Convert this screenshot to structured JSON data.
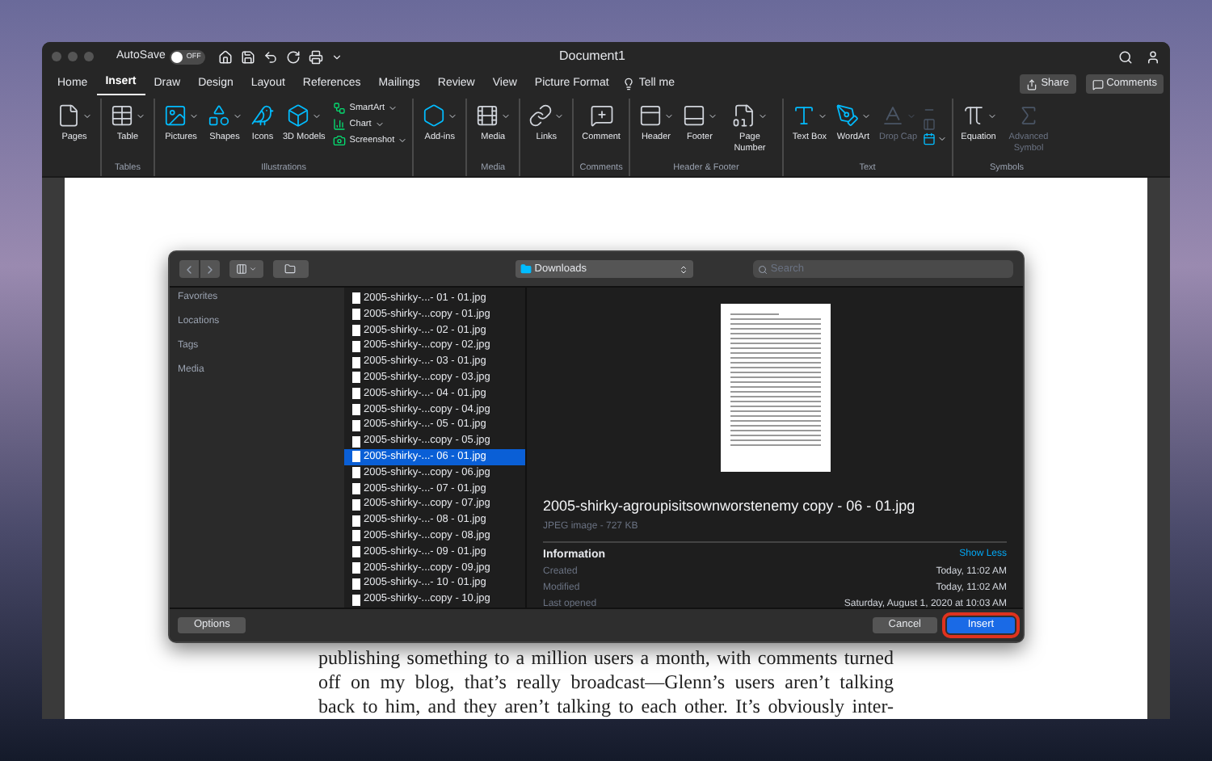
{
  "window": {
    "title": "Document1",
    "autosave": {
      "label": "AutoSave",
      "on": false,
      "state_label": "OFF"
    }
  },
  "tabs": [
    {
      "label": "Home",
      "selected": false
    },
    {
      "label": "Insert",
      "selected": true
    },
    {
      "label": "Draw",
      "selected": false
    },
    {
      "label": "Design",
      "selected": false
    },
    {
      "label": "Layout",
      "selected": false
    },
    {
      "label": "References",
      "selected": false
    },
    {
      "label": "Mailings",
      "selected": false
    },
    {
      "label": "Review",
      "selected": false
    },
    {
      "label": "View",
      "selected": false
    },
    {
      "label": "Picture Format",
      "selected": false
    }
  ],
  "tell_me": "Tell me",
  "share_button": "Share",
  "comments_button": "Comments",
  "ribbon": {
    "groups": [
      {
        "items": [
          {
            "label": "Pages",
            "kind": "menu_button",
            "disabled": false
          }
        ]
      },
      {
        "label": "Tables",
        "items": [
          {
            "label": "Table",
            "kind": "menu_button",
            "disabled": false
          }
        ]
      },
      {
        "label": "Illustrations",
        "items": [
          {
            "label": "Pictures",
            "kind": "menu_button",
            "disabled": false
          },
          {
            "label": "Shapes",
            "kind": "menu_button",
            "disabled": false
          },
          {
            "label": "Icons",
            "kind": "button",
            "disabled": false
          },
          {
            "label": "3D Models",
            "kind": "menu_button",
            "disabled": false
          },
          {
            "label": "SmartArt",
            "kind": "small_menu",
            "disabled": false
          },
          {
            "label": "Chart",
            "kind": "small_menu",
            "disabled": false
          },
          {
            "label": "Screenshot",
            "kind": "small_menu",
            "disabled": false
          }
        ]
      },
      {
        "items": [
          {
            "label": "Add-ins",
            "kind": "menu_button",
            "disabled": false
          }
        ]
      },
      {
        "label": "Media",
        "items": [
          {
            "label": "Media",
            "kind": "menu_button",
            "disabled": false
          }
        ]
      },
      {
        "items": [
          {
            "label": "Links",
            "kind": "menu_button",
            "disabled": false
          }
        ]
      },
      {
        "label": "Comments",
        "items": [
          {
            "label": "Comment",
            "kind": "button",
            "disabled": false
          }
        ]
      },
      {
        "label": "Header & Footer",
        "items": [
          {
            "label": "Header",
            "kind": "menu_button",
            "disabled": false
          },
          {
            "label": "Footer",
            "kind": "menu_button",
            "disabled": false
          },
          {
            "label": "Page Number",
            "kind": "menu_button",
            "disabled": false
          }
        ]
      },
      {
        "label": "Text",
        "items": [
          {
            "label": "Text Box",
            "kind": "menu_button",
            "disabled": false
          },
          {
            "label": "WordArt",
            "kind": "menu_button",
            "disabled": false
          },
          {
            "label": "Drop Cap",
            "kind": "menu_button",
            "disabled": true
          },
          {
            "kind": "icon_stack",
            "disabled": false
          }
        ]
      },
      {
        "label": "Symbols",
        "items": [
          {
            "label": "Equation",
            "kind": "menu_button",
            "disabled": false
          },
          {
            "label": "Advanced Symbol",
            "kind": "button",
            "disabled": true
          }
        ]
      }
    ]
  },
  "dialog": {
    "location": "Downloads",
    "search": {
      "placeholder": "Search"
    },
    "sidebar": [
      "Favorites",
      "Locations",
      "Tags",
      "Media"
    ],
    "files": [
      {
        "name": "2005-shirky-...- 01 - 01.jpg",
        "selected": false
      },
      {
        "name": "2005-shirky-...copy - 01.jpg",
        "selected": false
      },
      {
        "name": "2005-shirky-...- 02 - 01.jpg",
        "selected": false
      },
      {
        "name": "2005-shirky-...copy - 02.jpg",
        "selected": false
      },
      {
        "name": "2005-shirky-...- 03 - 01.jpg",
        "selected": false
      },
      {
        "name": "2005-shirky-...copy - 03.jpg",
        "selected": false
      },
      {
        "name": "2005-shirky-...- 04 - 01.jpg",
        "selected": false
      },
      {
        "name": "2005-shirky-...copy - 04.jpg",
        "selected": false
      },
      {
        "name": "2005-shirky-...- 05 - 01.jpg",
        "selected": false
      },
      {
        "name": "2005-shirky-...copy - 05.jpg",
        "selected": false
      },
      {
        "name": "2005-shirky-...- 06 - 01.jpg",
        "selected": true
      },
      {
        "name": "2005-shirky-...copy - 06.jpg",
        "selected": false
      },
      {
        "name": "2005-shirky-...- 07 - 01.jpg",
        "selected": false
      },
      {
        "name": "2005-shirky-...copy - 07.jpg",
        "selected": false
      },
      {
        "name": "2005-shirky-...- 08 - 01.jpg",
        "selected": false
      },
      {
        "name": "2005-shirky-...copy - 08.jpg",
        "selected": false
      },
      {
        "name": "2005-shirky-...- 09 - 01.jpg",
        "selected": false
      },
      {
        "name": "2005-shirky-...copy - 09.jpg",
        "selected": false
      },
      {
        "name": "2005-shirky-...- 10 - 01.jpg",
        "selected": false
      },
      {
        "name": "2005-shirky-...copy - 10.jpg",
        "selected": false
      }
    ],
    "preview": {
      "filename": "2005-shirky-agroupisitsownworstenemy copy - 06 - 01.jpg",
      "meta": "JPEG image - 727 KB",
      "info_heading": "Information",
      "toggle": "Show Less",
      "info": [
        {
          "label": "Created",
          "value": "Today, 11:02 AM"
        },
        {
          "label": "Modified",
          "value": "Today, 11:02 AM"
        },
        {
          "label": "Last opened",
          "value": "Saturday, August 1, 2020 at 10:03 AM"
        }
      ]
    },
    "buttons": {
      "options": "Options",
      "cancel": "Cancel",
      "insert": "Insert"
    }
  },
  "document": {
    "lines": [
      "publishing something to a million users a month, with comments turned",
      "off on my blog, that’s really broadcast—Glenn’s users aren’t talking",
      "back to him, and they aren’t talking to each other. It’s obviously inter-"
    ]
  }
}
